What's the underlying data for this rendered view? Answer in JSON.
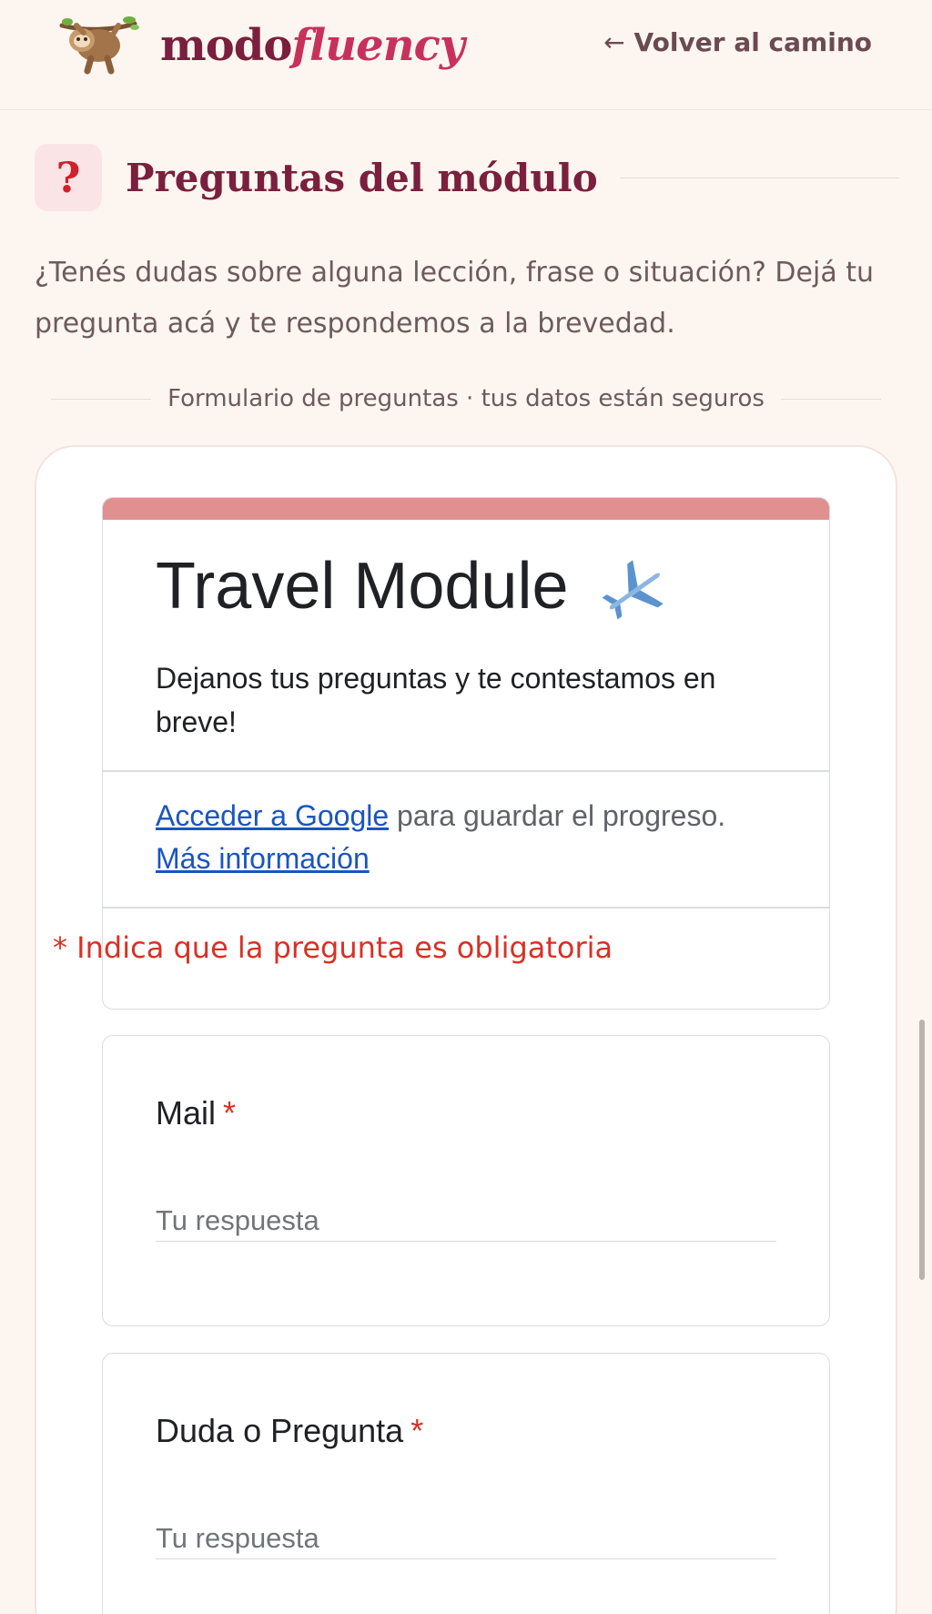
{
  "header": {
    "brand_main": "modo",
    "brand_accent": "fluency",
    "logo_icon": "sloth-icon",
    "back_arrow": "←",
    "back_label": "Volver al camino"
  },
  "section": {
    "badge": "?",
    "title": "Preguntas del módulo",
    "intro": "¿Tenés dudas sobre alguna lección, frase o situación? Dejá tu pregunta acá y te respondemos a la brevedad.",
    "divider_text": "Formulario de preguntas · tus datos están seguros"
  },
  "form": {
    "title": "Travel Module",
    "title_icon": "airplane-icon",
    "description": "Dejanos tus preguntas y te contestamos en breve!",
    "signin_link": "Acceder a Google",
    "signin_text": " para guardar el progreso.",
    "more_info_link": "Más información",
    "required_note": "* Indica que la pregunta es obligatoria",
    "questions": [
      {
        "label": "Mail",
        "required_mark": "*",
        "placeholder": "Tu respuesta",
        "value": ""
      },
      {
        "label": "Duda o Pregunta",
        "required_mark": "*",
        "placeholder": "Tu respuesta",
        "value": ""
      }
    ]
  },
  "colors": {
    "brand": "#7a1f3d",
    "brand_accent": "#c8325a",
    "form_accent": "#e0908f",
    "required": "#d93025",
    "link": "#1a55c0",
    "background": "#fdf6f0"
  }
}
